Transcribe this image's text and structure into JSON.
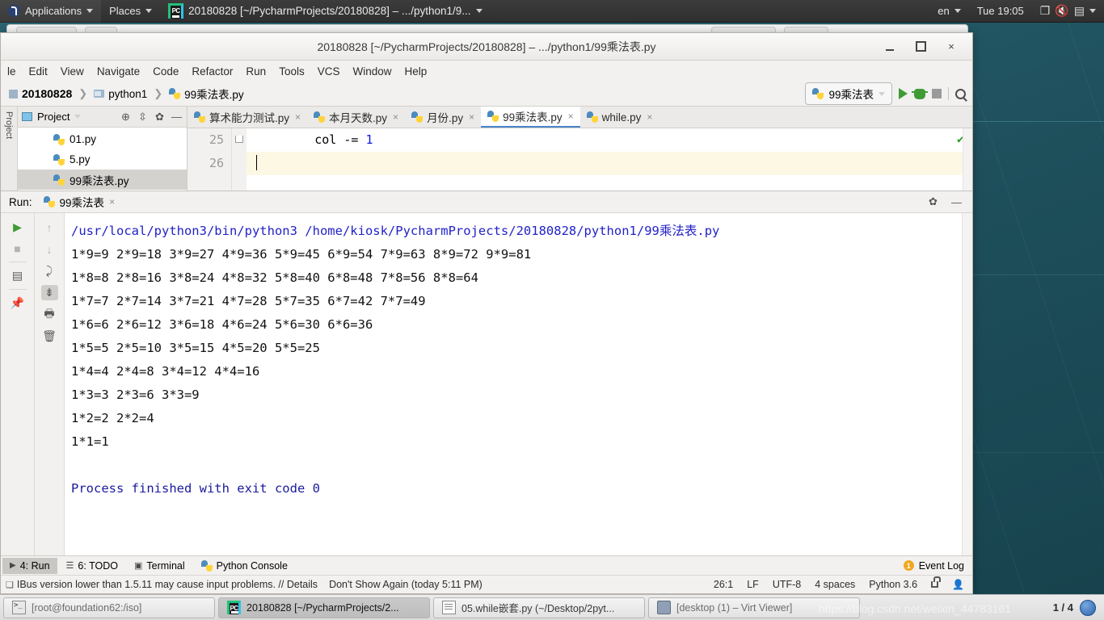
{
  "top_panel": {
    "applications": "Applications",
    "places": "Places",
    "window_title": "20180828 [~/PycharmProjects/20180828] – .../python1/9...",
    "input_source": "en",
    "clock": "Tue 19:05",
    "icons": [
      "fedora-logo-icon",
      "pycharm-icon",
      "display-icon",
      "volume-muted-icon",
      "battery-icon"
    ]
  },
  "ide": {
    "title": "20180828 [~/PycharmProjects/20180828] – .../python1/99乘法表.py",
    "window_buttons": {
      "minimize": "minimize-button",
      "maximize": "maximize-button",
      "close": "×"
    },
    "menu": [
      "le",
      "Edit",
      "View",
      "Navigate",
      "Code",
      "Refactor",
      "Run",
      "Tools",
      "VCS",
      "Window",
      "Help"
    ],
    "breadcrumb": [
      "20180828",
      "python1",
      "99乘法表.py"
    ],
    "run_config": "99乘法表",
    "project_panel": {
      "header": "Project",
      "files": [
        "01.py",
        "5.py",
        "99乘法表.py"
      ],
      "selected": "99乘法表.py"
    },
    "editor_tabs": [
      {
        "label": "算术能力测试.py",
        "active": false
      },
      {
        "label": "本月天数.py",
        "active": false
      },
      {
        "label": "月份.py",
        "active": false
      },
      {
        "label": "99乘法表.py",
        "active": true
      },
      {
        "label": "while.py",
        "active": false
      }
    ],
    "code": {
      "lines": [
        {
          "number": "25",
          "indent": "        ",
          "text": "col -= ",
          "number_literal": "1"
        },
        {
          "number": "26",
          "indent": "",
          "text": "",
          "number_literal": ""
        }
      ]
    },
    "run_window": {
      "label": "Run:",
      "tab": "99乘法表",
      "console_lines": [
        {
          "kind": "cmd",
          "text": "/usr/local/python3/bin/python3 /home/kiosk/PycharmProjects/20180828/python1/99乘法表.py"
        },
        {
          "kind": "out",
          "text": "1*9=9 2*9=18 3*9=27 4*9=36 5*9=45 6*9=54 7*9=63 8*9=72 9*9=81"
        },
        {
          "kind": "out",
          "text": "1*8=8 2*8=16 3*8=24 4*8=32 5*8=40 6*8=48 7*8=56 8*8=64"
        },
        {
          "kind": "out",
          "text": "1*7=7 2*7=14 3*7=21 4*7=28 5*7=35 6*7=42 7*7=49"
        },
        {
          "kind": "out",
          "text": "1*6=6 2*6=12 3*6=18 4*6=24 5*6=30 6*6=36"
        },
        {
          "kind": "out",
          "text": "1*5=5 2*5=10 3*5=15 4*5=20 5*5=25"
        },
        {
          "kind": "out",
          "text": "1*4=4 2*4=8 3*4=12 4*4=16"
        },
        {
          "kind": "out",
          "text": "1*3=3 2*3=6 3*3=9"
        },
        {
          "kind": "out",
          "text": "1*2=2 2*2=4"
        },
        {
          "kind": "out",
          "text": "1*1=1"
        },
        {
          "kind": "out",
          "text": ""
        },
        {
          "kind": "done",
          "text": "Process finished with exit code 0"
        }
      ]
    },
    "status_buttons": [
      {
        "label": "4: Run",
        "active": true
      },
      {
        "label": "6: TODO",
        "active": false
      },
      {
        "label": "Terminal",
        "active": false
      },
      {
        "label": "Python Console",
        "active": false
      }
    ],
    "event_log": {
      "label": "Event Log",
      "count": "1"
    },
    "status_bar": {
      "message": "IBus version lower than 1.5.11 may cause input problems. // Details",
      "dismiss": "Don't Show Again (today 5:11 PM)",
      "caret": "26:1",
      "line_sep": "LF",
      "encoding": "UTF-8",
      "indent": "4 spaces",
      "interpreter": "Python 3.6"
    }
  },
  "taskbar": {
    "items": [
      {
        "label": "[root@foundation62:/iso]",
        "icon": "terminal-icon",
        "active": false
      },
      {
        "label": "20180828 [~/PycharmProjects/2...",
        "icon": "pycharm-icon",
        "active": true
      },
      {
        "label": "05.while嵌套.py (~/Desktop/2pyt...",
        "icon": "text-editor-icon",
        "active": false
      },
      {
        "label": "[desktop (1) – Virt Viewer]",
        "icon": "monitor-icon",
        "active": false
      }
    ],
    "workspace": "1 / 4"
  },
  "watermark": "https://blog.csdn.net/weixin_44783161",
  "colors": {
    "desktop": "#1f5561",
    "accent_blue": "#4a86c8",
    "run_green": "#3f9c35",
    "console_cmd": "#2222c8",
    "console_done": "#1a1a9e",
    "highlight_line": "#fcf8e4"
  }
}
